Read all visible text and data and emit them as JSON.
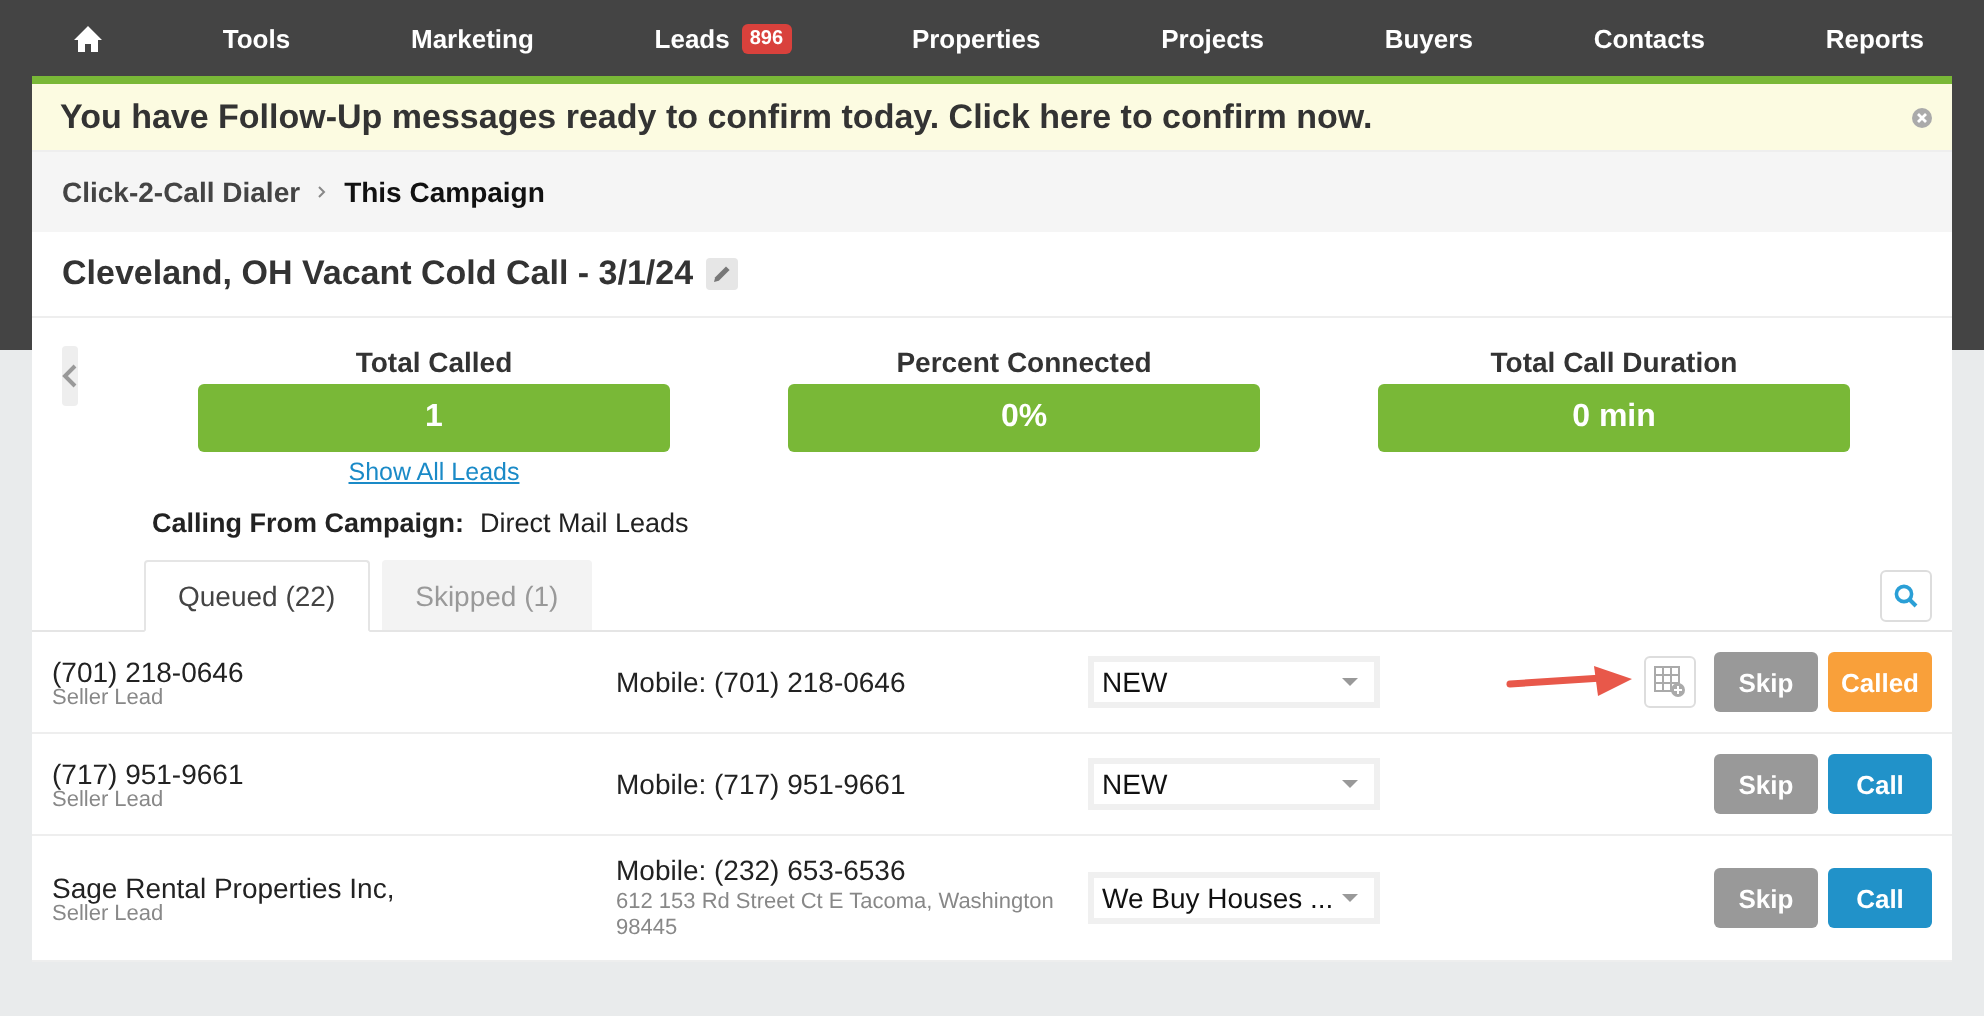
{
  "nav": {
    "items": [
      {
        "kind": "home"
      },
      {
        "kind": "text",
        "label": "Tools"
      },
      {
        "kind": "text",
        "label": "Marketing"
      },
      {
        "kind": "text",
        "label": "Leads",
        "badge": "896"
      },
      {
        "kind": "text",
        "label": "Properties"
      },
      {
        "kind": "text",
        "label": "Projects"
      },
      {
        "kind": "text",
        "label": "Buyers"
      },
      {
        "kind": "text",
        "label": "Contacts"
      },
      {
        "kind": "text",
        "label": "Reports"
      }
    ]
  },
  "banner": {
    "text": "You have Follow-Up messages ready to confirm today. Click here to confirm now."
  },
  "breadcrumb": [
    "Click-2-Call Dialer",
    "This Campaign"
  ],
  "title": "Cleveland, OH Vacant Cold Call - 3/1/24",
  "stats": [
    {
      "label": "Total Called",
      "value": "1",
      "link": "Show All Leads"
    },
    {
      "label": "Percent Connected",
      "value": "0%"
    },
    {
      "label": "Total Call Duration",
      "value": "0 min"
    }
  ],
  "calling_from": {
    "label": "Calling From Campaign:",
    "value": "Direct Mail Leads"
  },
  "tabs": [
    {
      "label": "Queued (22)",
      "selected": true
    },
    {
      "label": "Skipped (1)",
      "selected": false
    }
  ],
  "rows": [
    {
      "name": "(701) 218-0646",
      "type": "Seller Lead",
      "phone": "Mobile: (701) 218-0646",
      "status": "NEW",
      "marked": true,
      "skip": "Skip",
      "action": "Called",
      "kind": "called"
    },
    {
      "name": "(717) 951-9661",
      "type": "Seller Lead",
      "phone": "Mobile: (717) 951-9661",
      "status": "NEW",
      "marked": false,
      "skip": "Skip",
      "action": "Call",
      "kind": "call"
    },
    {
      "name": "Sage Rental Properties Inc,",
      "type": "Seller Lead",
      "phone": "Mobile: (232) 653-6536",
      "address": "612 153 Rd Street Ct E Tacoma, Washington 98445",
      "status": "We Buy Houses ...",
      "marked": false,
      "skip": "Skip",
      "action": "Call",
      "kind": "call"
    }
  ]
}
